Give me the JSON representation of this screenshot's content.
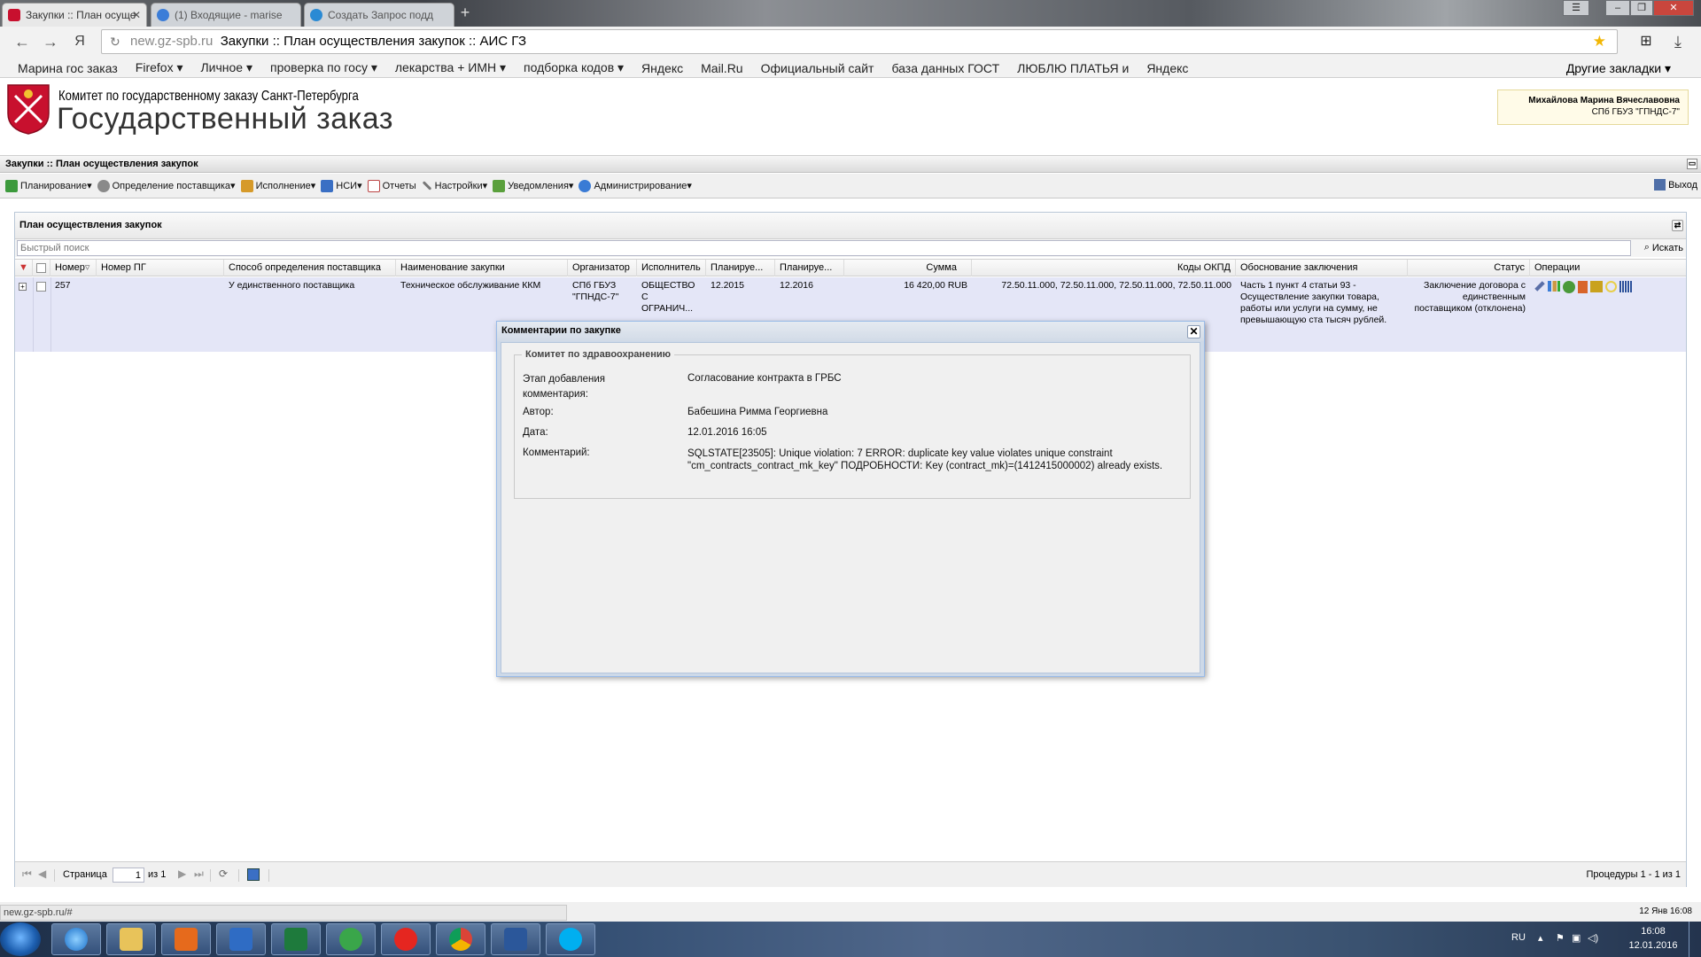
{
  "browser": {
    "tabs": [
      {
        "title": "Закупки :: План осуще"
      },
      {
        "title": "(1) Входящие - marise"
      },
      {
        "title": "Создать Запрос подд"
      }
    ],
    "address_host": "new.gz-spb.ru",
    "address_title": "Закупки :: План осуществления закупок :: АИС ГЗ",
    "bookmarks": [
      "Марина гос заказ",
      "Firefox ▾",
      "Личное ▾",
      "проверка по госу ▾",
      "лекарства + ИМН ▾",
      "подборка кодов ▾",
      "Яндекс",
      "Mail.Ru",
      "Официальный сайт",
      "база данных ГОСТ",
      "ЛЮБЛЮ ПЛАТЬЯ и",
      "Яндекс"
    ],
    "other_bookmarks": "Другие закладки ▾",
    "yandex_glyph": "Я"
  },
  "header": {
    "org": "Комитет по государственному заказу Санкт-Петербурга",
    "title": "Государственный заказ",
    "user_name": "Михайлова Марина Вячеславовна",
    "user_org": "СПб ГБУЗ \"ГПНДС-7\""
  },
  "panel": {
    "breadcrumb": "Закупки :: План осуществления закупок",
    "menu": [
      "Планирование",
      "Определение поставщика",
      "Исполнение",
      "НСИ",
      "Отчеты",
      "Настройки",
      "Уведомления",
      "Администрирование"
    ],
    "logout": "Выход"
  },
  "grid": {
    "title": "План осуществления закупок",
    "search_placeholder": "Быстрый поиск",
    "search_button": "Искать",
    "columns": [
      "Номер",
      "Номер ПГ",
      "Способ определения поставщика",
      "Наименование закупки",
      "Организатор",
      "Исполнитель",
      "Планируе...",
      "Планируе...",
      "Сумма",
      "Коды ОКПД",
      "Обоснование заключения",
      "Статус",
      "Операции"
    ],
    "row": {
      "number": "257",
      "pg_number": "",
      "method": "У единственного поставщика",
      "name": "Техническое обслуживание ККМ",
      "organizer": "СПб ГБУЗ \"ГПНДС-7\"",
      "executor": "ОБЩЕСТВО С ОГРАНИЧ...",
      "plan1": "12.2015",
      "plan2": "12.2016",
      "sum": "16 420,00 RUB",
      "okpd": "72.50.11.000, 72.50.11.000, 72.50.11.000, 72.50.11.000",
      "justification": "Часть 1 пункт 4 статьи 93 - Осуществление закупки товара, работы или услуги на сумму, не превышающую ста тысяч рублей.",
      "status": "Заключение договора с единственным поставщиком (отклонена)"
    },
    "pager": {
      "page_label": "Страница",
      "page_value": "1",
      "of_label": "из 1",
      "summary": "Процедуры 1 - 1 из 1"
    }
  },
  "dialog": {
    "title": "Комментарии по закупке",
    "group": "Комитет по здравоохранению",
    "fields": [
      {
        "label": "Этап добавления комментария:",
        "value": "Согласование контракта в ГРБС"
      },
      {
        "label": "Автор:",
        "value": "Бабешина Римма Георгиевна"
      },
      {
        "label": "Дата:",
        "value": "12.01.2016 16:05"
      },
      {
        "label": "Комментарий:",
        "value": "SQLSTATE[23505]: Unique violation: 7 ERROR: duplicate key value violates unique constraint \"cm_contracts_contract_mk_key\" ПОДРОБНОСТИ: Key (contract_mk)=(1412415000002) already exists."
      }
    ]
  },
  "statusbar": {
    "url": "new.gz-spb.ru/#",
    "datetime": "12 Янв 16:08"
  },
  "taskbar": {
    "lang": "RU",
    "time": "16:08",
    "date": "12.01.2016"
  },
  "colors": {
    "row_highlight": "#e4e6f7",
    "dialog_frame": "#cdd9e8",
    "user_box": "#fffbe8"
  }
}
